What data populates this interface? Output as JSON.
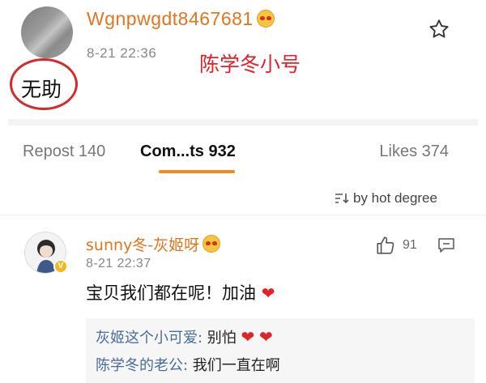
{
  "post": {
    "username": "Wgnpwgdt8467681",
    "timestamp": "8-21 22:36",
    "caption_annotation": "陈学冬小号",
    "circled_text": "无助"
  },
  "tabs": {
    "repost": "Repost 140",
    "comments": "Com...ts 932",
    "likes": "Likes 374"
  },
  "sort": {
    "label": "by hot degree"
  },
  "comment": {
    "username": "sunny冬-灰姬呀",
    "timestamp": "8-21 22:37",
    "like_count": "91",
    "text": "宝贝我们都在呢！加油",
    "replies": [
      {
        "name": "灰姬这个小可爱:",
        "text": " 别怕"
      },
      {
        "name": "陈学冬的老公:",
        "text": " 我们一直在啊"
      }
    ]
  },
  "colors": {
    "username_orange": "#e0751f",
    "active_tab_underline": "#f08a24",
    "annotation_red": "#e2222b",
    "heart_red": "#e0242c",
    "reply_name_blue": "#4a6c97"
  }
}
